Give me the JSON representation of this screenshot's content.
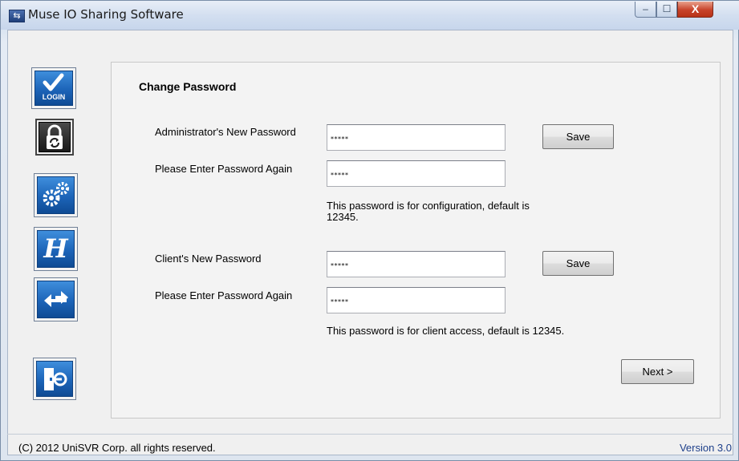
{
  "window": {
    "title": "Muse IO Sharing Software",
    "controls": {
      "minimize": "–",
      "maximize": "☐",
      "close": "X"
    }
  },
  "sidebar": {
    "items": [
      {
        "name": "login",
        "label": "LOGIN",
        "icon": "check-icon"
      },
      {
        "name": "change-password",
        "icon": "lock-refresh-icon",
        "active": true
      },
      {
        "name": "settings",
        "icon": "gears-icon"
      },
      {
        "name": "help",
        "icon": "script-h-icon",
        "glyph": "H"
      },
      {
        "name": "sharing",
        "icon": "double-arrow-icon",
        "glyph": "⇆"
      },
      {
        "name": "exit",
        "icon": "exit-door-icon"
      }
    ]
  },
  "main": {
    "title": "Change Password",
    "admin": {
      "new_label": "Administrator's New Password",
      "new_value": "*****",
      "again_label": "Please Enter Password Again",
      "again_value": "*****",
      "save_label": "Save",
      "note": "This password is for configuration, default is 12345."
    },
    "client": {
      "new_label": "Client's New Password",
      "new_value": "*****",
      "again_label": "Please Enter Password Again",
      "again_value": "*****",
      "save_label": "Save",
      "note": "This password is for client access, default is 12345."
    },
    "next_label": "Next >"
  },
  "footer": {
    "copyright": "(C) 2012 UniSVR Corp. all rights reserved.",
    "version": "Version 3.0"
  },
  "colors": {
    "accent": "#1c64b8",
    "close": "#c7432a",
    "version_text": "#1d3f8a"
  }
}
